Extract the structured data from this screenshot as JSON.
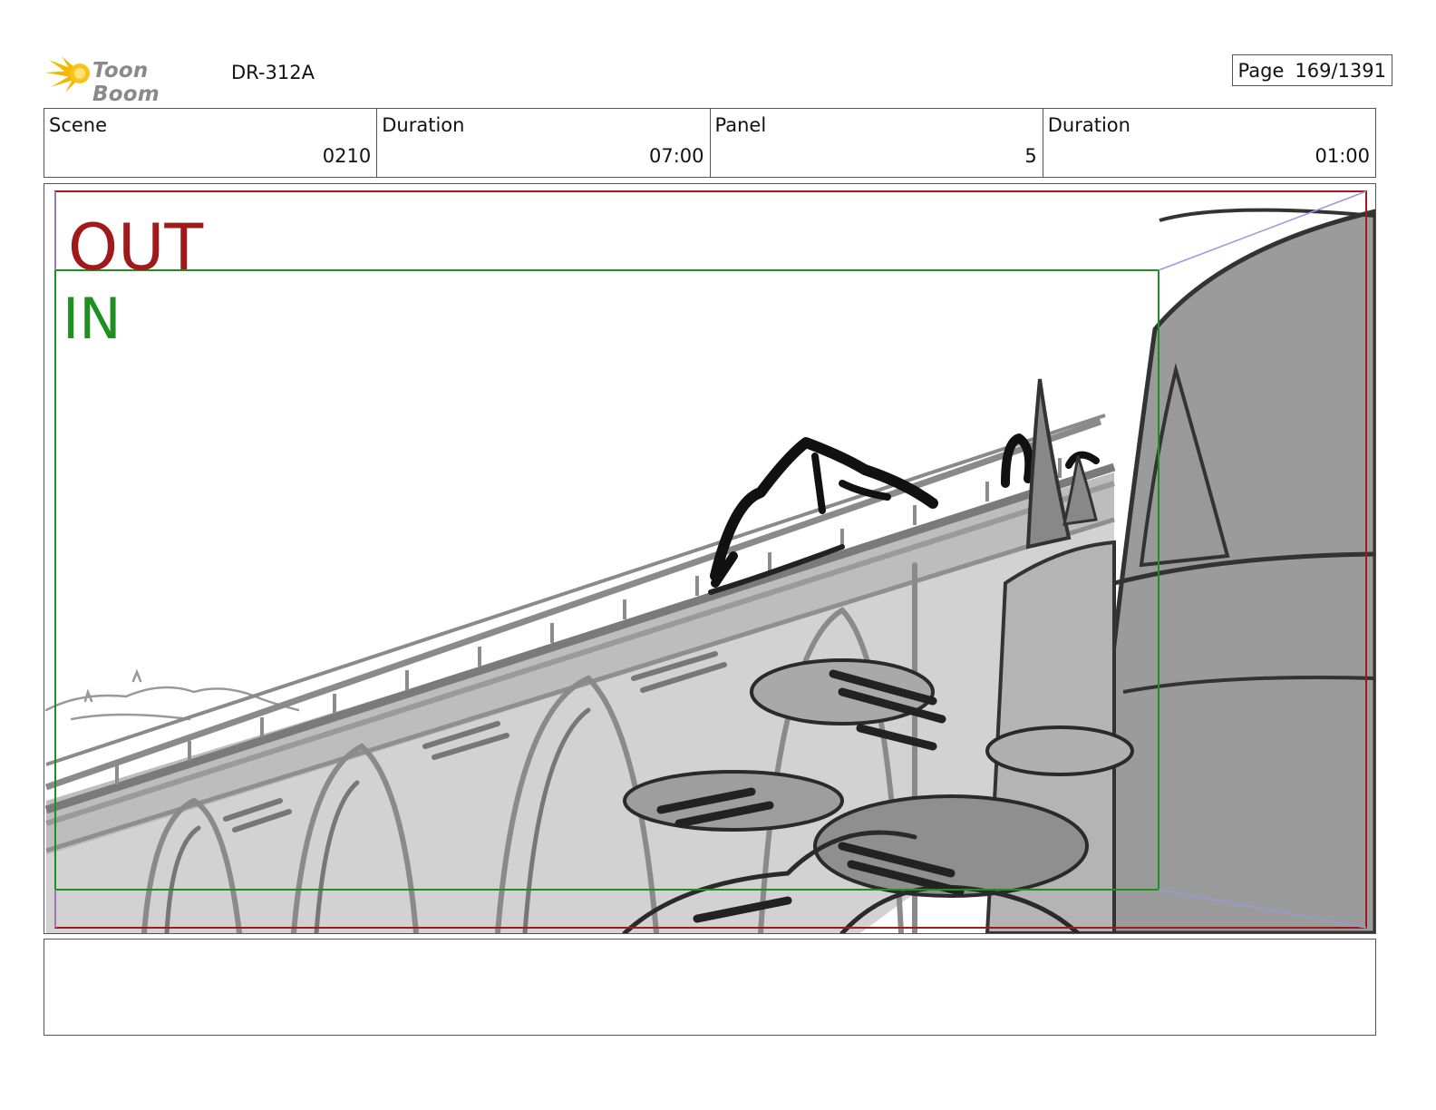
{
  "header": {
    "logo_text": "Toon Boom",
    "doc_id": "DR-312A",
    "page_label": "Page",
    "page_value": "169/1391"
  },
  "info": {
    "scene_label": "Scene",
    "scene_value": "0210",
    "scene_duration_label": "Duration",
    "scene_duration_value": "07:00",
    "panel_label": "Panel",
    "panel_value": "5",
    "panel_duration_label": "Duration",
    "panel_duration_value": "01:00"
  },
  "panel": {
    "out_label": "OUT",
    "in_label": "IN",
    "colors": {
      "out_frame": "#a11a1a",
      "in_frame": "#1f8f1f",
      "camera_lines": "#9999dd"
    }
  },
  "notes": {
    "text": ""
  }
}
